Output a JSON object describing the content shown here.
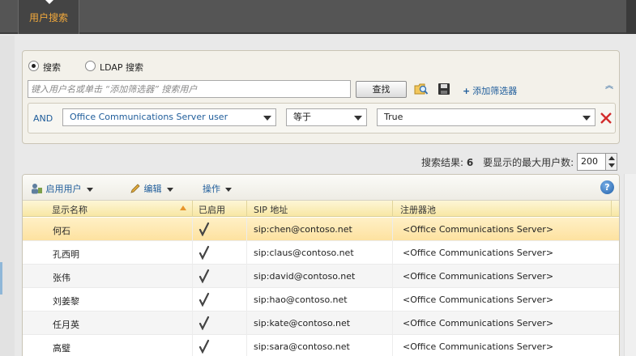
{
  "top": {
    "tab_label": "用户搜索"
  },
  "search": {
    "mode_search_label": "搜索",
    "mode_ldap_label": "LDAP 搜索",
    "selected_mode": "搜索",
    "placeholder": "键入用户名或单击 “添加筛选器” 搜索用户",
    "find_button": "查找",
    "add_filter_label": "添加筛选器",
    "filter": {
      "conjunction": "AND",
      "attribute": "Office Communications Server user",
      "operator": "等于",
      "value": "True"
    }
  },
  "results": {
    "count_label": "搜索结果:",
    "count": "6",
    "max_users_label": "要显示的最大用户数:",
    "max_users": "200"
  },
  "toolbar": {
    "enable_users": "启用用户",
    "edit": "编辑",
    "actions": "操作"
  },
  "table": {
    "columns": [
      "显示名称",
      "已启用",
      "SIP 地址",
      "注册器池"
    ],
    "sort_column": "显示名称",
    "rows": [
      {
        "name": "何石",
        "enabled": true,
        "sip": "sip:chen@contoso.net",
        "pool": "<Office Communications Server>"
      },
      {
        "name": "孔西明",
        "enabled": true,
        "sip": "sip:claus@contoso.net",
        "pool": "<Office Communications Server>"
      },
      {
        "name": "张伟",
        "enabled": true,
        "sip": "sip:david@contoso.net",
        "pool": "<Office Communications Server>"
      },
      {
        "name": "刘姜黎",
        "enabled": true,
        "sip": "sip:hao@contoso.net",
        "pool": "<Office Communications Server>"
      },
      {
        "name": "任月英",
        "enabled": true,
        "sip": "sip:kate@contoso.net",
        "pool": "<Office Communications Server>"
      },
      {
        "name": "高璧",
        "enabled": true,
        "sip": "sip:sara@contoso.net",
        "pool": "<Office Communications Server>"
      }
    ]
  },
  "colors": {
    "accent_orange": "#f2a93b",
    "link_blue": "#1e5c9a",
    "header_yellow": "#f8e7a4",
    "selected_row": "#fde2a0",
    "delete_red": "#d22b2b"
  }
}
